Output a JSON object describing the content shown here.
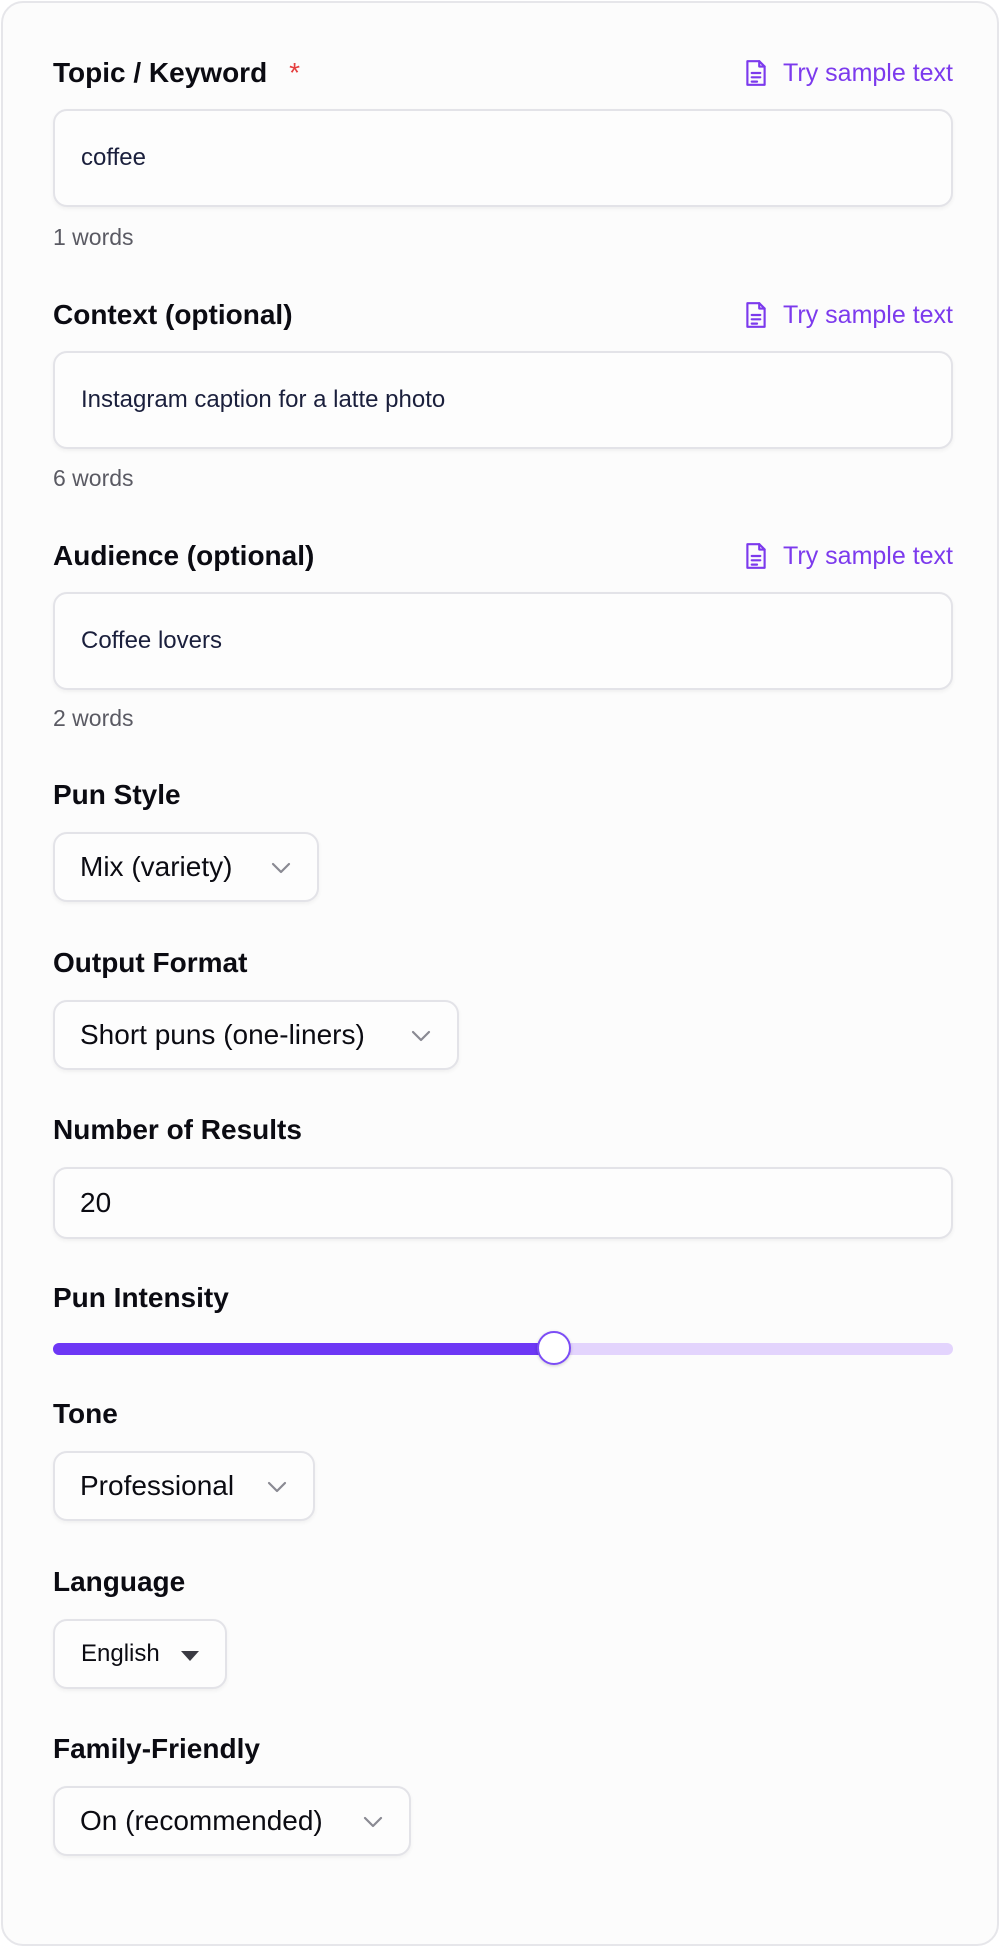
{
  "fields": {
    "topic": {
      "label": "Topic / Keyword",
      "required_mark": "*",
      "sample_link": "Try sample text",
      "value": "coffee",
      "word_count": "1 words"
    },
    "context": {
      "label": "Context (optional)",
      "sample_link": "Try sample text",
      "value": "Instagram caption for a latte photo",
      "word_count": "6 words"
    },
    "audience": {
      "label": "Audience (optional)",
      "sample_link": "Try sample text",
      "value": "Coffee lovers",
      "word_count": "2 words"
    }
  },
  "pun_style": {
    "label": "Pun Style",
    "selected": "Mix (variety)"
  },
  "output_format": {
    "label": "Output Format",
    "selected": "Short puns (one-liners)"
  },
  "number_of_results": {
    "label": "Number of Results",
    "value": "20"
  },
  "pun_intensity": {
    "label": "Pun Intensity",
    "level_fraction": 0.557
  },
  "tone": {
    "label": "Tone",
    "selected": "Professional"
  },
  "language": {
    "label": "Language",
    "selected": "English"
  },
  "family_friendly": {
    "label": "Family-Friendly",
    "selected": "On (recommended)"
  },
  "icons": {
    "sample": "document-text-icon",
    "dropdown": "chevron-down-icon",
    "native_dropdown": "caret-down-icon"
  },
  "colors": {
    "accent": "#7c3aed",
    "required": "#e53e3e",
    "slider_fill": "#6d37f5",
    "slider_track": "#e3d4fd"
  }
}
